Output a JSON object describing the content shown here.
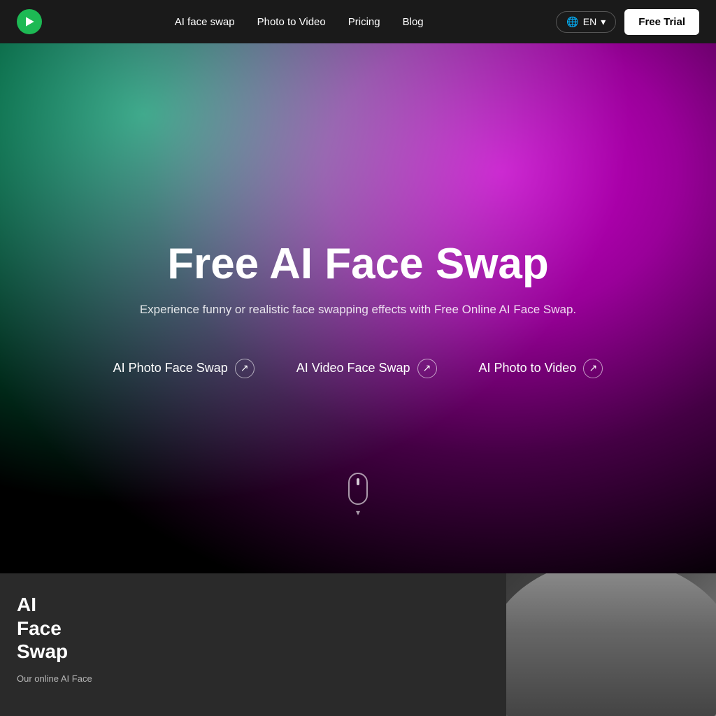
{
  "nav": {
    "logo_alt": "Pictory",
    "links": [
      {
        "id": "ai-face-swap",
        "label": "AI face swap"
      },
      {
        "id": "photo-to-video",
        "label": "Photo to Video"
      },
      {
        "id": "pricing",
        "label": "Pricing"
      },
      {
        "id": "blog",
        "label": "Blog"
      }
    ],
    "lang_label": "EN",
    "free_trial_label": "Free Trial"
  },
  "hero": {
    "title": "Free AI Face Swap",
    "subtitle": "Experience funny or realistic face swapping effects with Free Online AI Face Swap.",
    "links": [
      {
        "id": "photo-face-swap",
        "label": "AI Photo Face Swap"
      },
      {
        "id": "video-face-swap",
        "label": "AI Video Face Swap"
      },
      {
        "id": "photo-to-video",
        "label": "AI Photo to Video"
      }
    ]
  },
  "bottom": {
    "title": "AI\nFace\nSwap",
    "description": "Our online AI Face"
  },
  "icons": {
    "globe": "🌐",
    "chevron_down": "▾",
    "arrow_up_right": "↗"
  }
}
